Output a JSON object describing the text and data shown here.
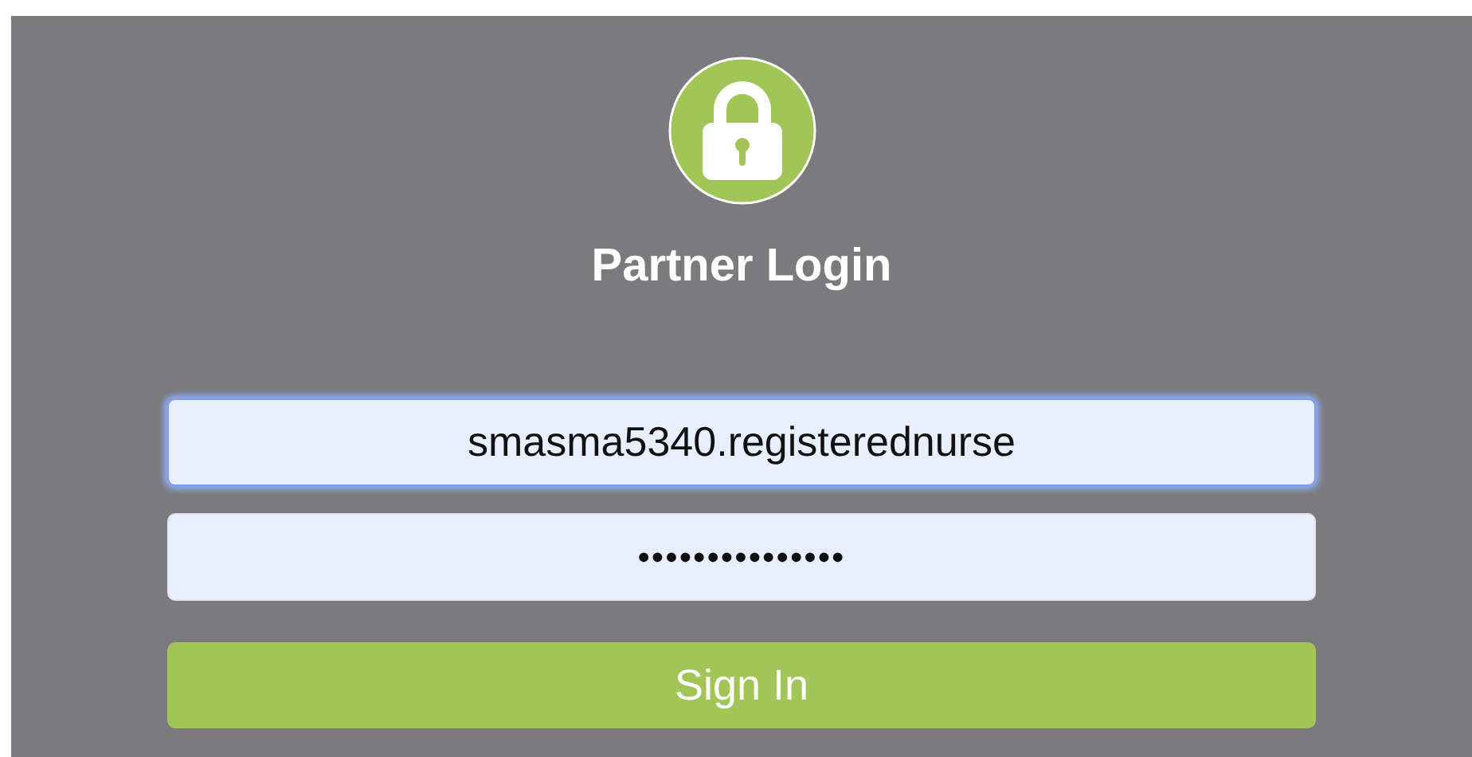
{
  "title": "Partner Login",
  "fields": [
    {
      "kind": "username",
      "value": "smasma5340.registerednurse",
      "focused": true
    },
    {
      "kind": "password",
      "value": "•••••••••••••••",
      "focused": false
    }
  ],
  "button": {
    "label": "Sign In"
  }
}
